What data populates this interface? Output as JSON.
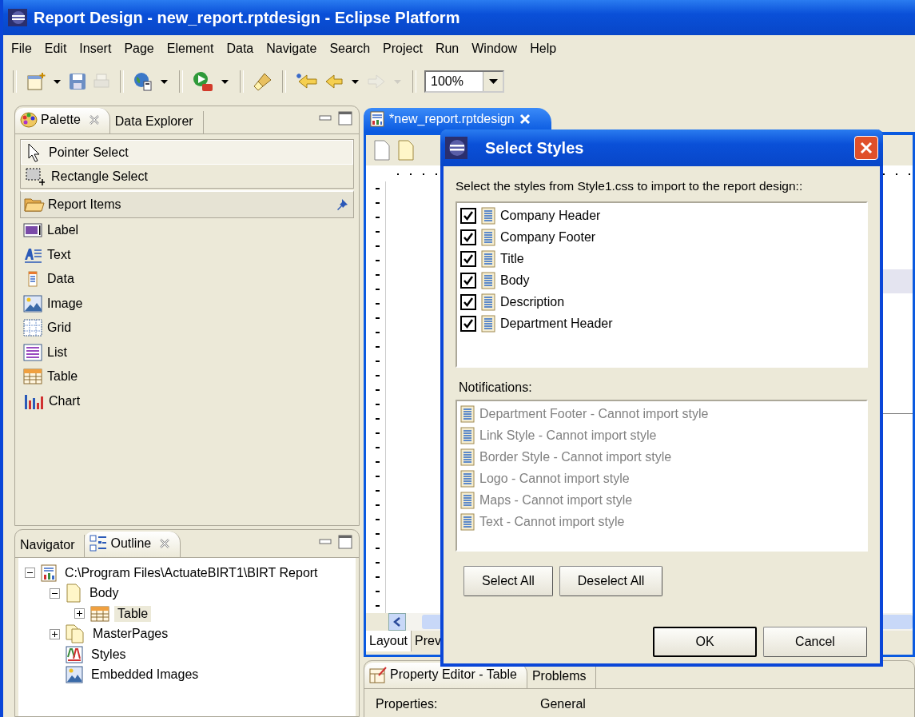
{
  "window": {
    "title": "Report Design - new_report.rptdesign - Eclipse Platform"
  },
  "menu": [
    "File",
    "Edit",
    "Insert",
    "Page",
    "Element",
    "Data",
    "Navigate",
    "Search",
    "Project",
    "Run",
    "Window",
    "Help"
  ],
  "toolbar": {
    "groups": [
      [
        {
          "kind": "new",
          "disabled": false
        },
        {
          "kind": "caret",
          "disabled": false
        },
        {
          "kind": "save",
          "disabled": false
        },
        {
          "kind": "print",
          "disabled": true
        }
      ],
      [
        {
          "kind": "globe",
          "disabled": false
        },
        {
          "kind": "caret",
          "disabled": false
        }
      ],
      [
        {
          "kind": "run",
          "disabled": false
        },
        {
          "kind": "caret",
          "disabled": false
        }
      ],
      [
        {
          "kind": "brush",
          "disabled": false
        }
      ],
      [
        {
          "kind": "last-edit",
          "disabled": false
        },
        {
          "kind": "back",
          "disabled": false
        },
        {
          "kind": "caret",
          "disabled": false
        },
        {
          "kind": "forward",
          "disabled": true
        },
        {
          "kind": "caret",
          "disabled": true
        }
      ]
    ],
    "zoom": "100%"
  },
  "palette": {
    "tabs": [
      {
        "label": "Palette",
        "selected": true
      },
      {
        "label": "Data Explorer",
        "selected": false
      }
    ],
    "tools": [
      {
        "label": "Pointer Select",
        "kind": "pointer",
        "selected": true
      },
      {
        "label": "Rectangle Select",
        "kind": "marquee",
        "selected": false
      }
    ],
    "drawer": {
      "label": "Report Items",
      "pinned": true
    },
    "items": [
      {
        "label": "Label",
        "kind": "label"
      },
      {
        "label": "Text",
        "kind": "text"
      },
      {
        "label": "Data",
        "kind": "data"
      },
      {
        "label": "Image",
        "kind": "image"
      },
      {
        "label": "Grid",
        "kind": "grid"
      },
      {
        "label": "List",
        "kind": "list"
      },
      {
        "label": "Table",
        "kind": "table"
      },
      {
        "label": "Chart",
        "kind": "chart"
      }
    ]
  },
  "outline": {
    "tabs": [
      {
        "label": "Navigator",
        "selected": false
      },
      {
        "label": "Outline",
        "selected": true
      }
    ],
    "tree": [
      {
        "label": "C:\\Program Files\\ActuateBIRT1\\BIRT Report",
        "kind": "report",
        "expanded": true,
        "selected": false,
        "children": [
          {
            "label": "Body",
            "kind": "body",
            "expanded": true,
            "selected": false,
            "children": [
              {
                "label": "Table",
                "kind": "table",
                "expanded": false,
                "selected": true
              }
            ]
          },
          {
            "label": "MasterPages",
            "kind": "pages",
            "expanded": false,
            "selected": false
          },
          {
            "label": "Styles",
            "kind": "styles",
            "selected": false
          },
          {
            "label": "Embedded Images",
            "kind": "image",
            "selected": false
          }
        ]
      }
    ]
  },
  "editor": {
    "tab": "*new_report.rptdesign",
    "bottom_tabs": [
      {
        "label": "Layout",
        "selected": true
      },
      {
        "label": "Prev",
        "selected": false
      }
    ]
  },
  "dialog": {
    "title": "Select Styles",
    "prompt": "Select the styles from Style1.css to import to the report design::",
    "styles": [
      {
        "label": "Company Header",
        "checked": true
      },
      {
        "label": "Company Footer",
        "checked": true
      },
      {
        "label": "Title",
        "checked": true
      },
      {
        "label": "Body",
        "checked": true
      },
      {
        "label": "Description",
        "checked": true
      },
      {
        "label": "Department Header",
        "checked": true
      }
    ],
    "notifications_label": "Notifications:",
    "notifications": [
      "Department Footer - Cannot import style",
      "Link Style - Cannot import style",
      "Border Style - Cannot import style",
      "Logo - Cannot import style",
      "Maps - Cannot import style",
      "Text - Cannot import style"
    ],
    "left_buttons": [
      "Select All",
      "Deselect All"
    ],
    "buttons": [
      {
        "label": "OK",
        "default": true
      },
      {
        "label": "Cancel",
        "default": false
      }
    ]
  },
  "properties": {
    "tabs": [
      {
        "label": "Property Editor - Table",
        "selected": true
      },
      {
        "label": "Problems",
        "selected": false
      }
    ],
    "label": "Properties:",
    "section": "General"
  }
}
